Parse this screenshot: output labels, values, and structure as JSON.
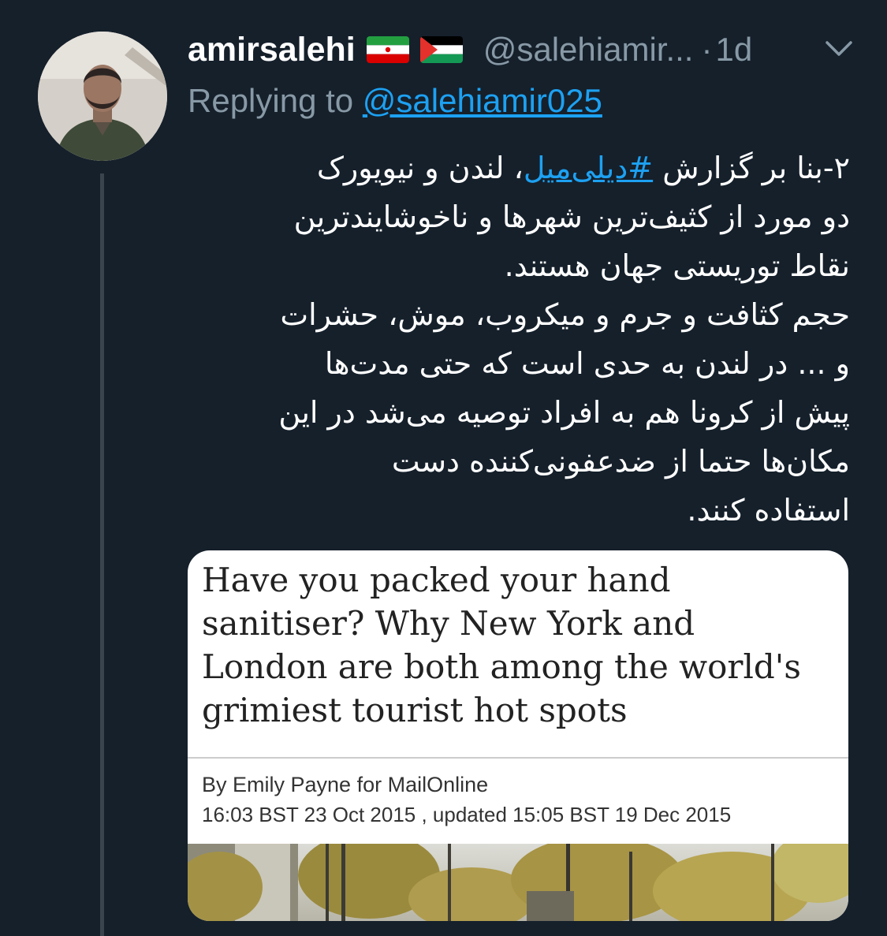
{
  "user": {
    "display_name": "amirsalehi",
    "handle": "@salehiamir...",
    "separator": "·",
    "time": "1d",
    "flags": [
      "iran-flag",
      "palestine-flag"
    ]
  },
  "reply": {
    "prefix": "Replying to ",
    "mention": "@salehiamir025"
  },
  "body": {
    "line1_prefix": "۲-بنا بر گزارش ",
    "hashtag": "#دیلی‌میل",
    "line1_suffix": "، لندن و نیویورک",
    "lines": [
      "دو مورد از کثیف‌ترین شهرها و ناخوشایندترین",
      "نقاط توریستی جهان هستند.",
      "حجم کثافت و جرم و میکروب، موش، حشرات",
      "و ... در لندن به حدی است که حتی مدت‌ها",
      "پیش از کرونا هم به افراد توصیه می‌شد در این",
      "مکان‌ها حتما از ضدعفونی‌کننده دست",
      "استفاده کنند."
    ]
  },
  "card": {
    "headline_lines": [
      "Have you packed your hand",
      "sanitiser? Why New York and",
      "London are both among the world's",
      "grimiest tourist hot spots"
    ],
    "byline": "By Emily Payne for MailOnline",
    "dates": "16:03 BST 23 Oct 2015 , updated 15:05 BST 19 Dec 2015"
  },
  "colors": {
    "background": "#15202b",
    "secondary_text": "#8899a6",
    "link": "#1da1f2"
  },
  "icons": {
    "caret": "chevron-down-icon"
  }
}
